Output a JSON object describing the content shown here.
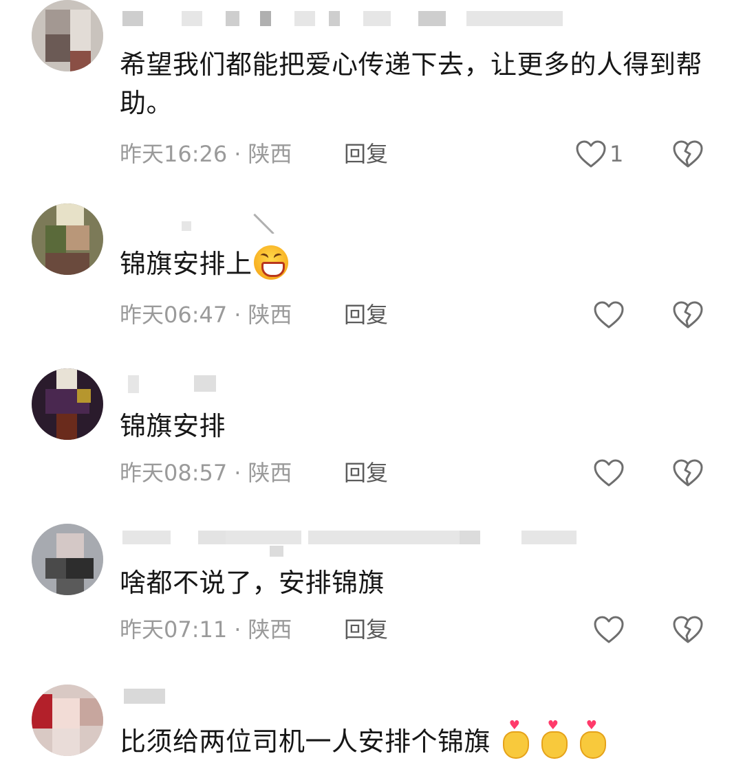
{
  "comments": [
    {
      "text": "希望我们都能把爱心传递下去，让更多的人得到帮助。",
      "time": "昨天16:26",
      "location": "陕西",
      "reply_label": "回复",
      "like_count": "1"
    },
    {
      "text": "锦旗安排上",
      "time": "昨天06:47",
      "location": "陕西",
      "reply_label": "回复",
      "like_count": "",
      "emoji": "grinning-squinting-face"
    },
    {
      "text": "锦旗安排",
      "time": "昨天08:57",
      "location": "陕西",
      "reply_label": "回复",
      "like_count": ""
    },
    {
      "text": "啥都不说了，安排锦旗",
      "time": "昨天07:11",
      "location": "陕西",
      "reply_label": "回复",
      "like_count": ""
    },
    {
      "text": "比须给两位司机一人安排个锦旗",
      "emoji": "hand-with-index-finger-and-thumb-crossed",
      "emoji_count": 3
    }
  ],
  "separator": "·",
  "icons": {
    "like": "heart-outline-icon",
    "dislike": "broken-heart-icon"
  },
  "colors": {
    "text": "#161616",
    "meta": "#9a9a9a",
    "reply": "#5b5b5b",
    "icon": "#6e6e6e"
  }
}
